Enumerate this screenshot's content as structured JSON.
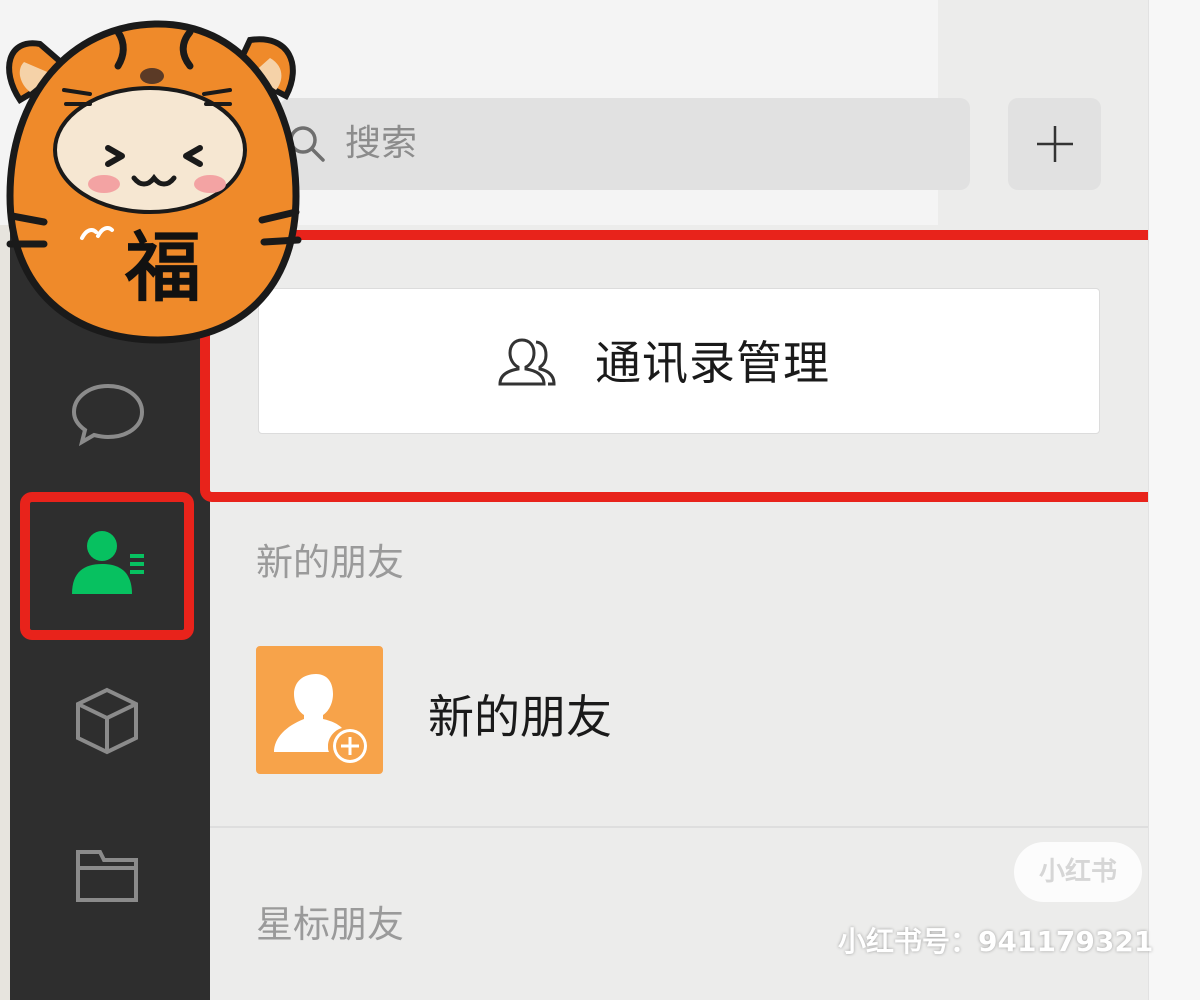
{
  "sticker": {
    "char": "福"
  },
  "search": {
    "placeholder": "搜索"
  },
  "toolbar": {
    "add_label": "+"
  },
  "manage": {
    "label": "通讯录管理"
  },
  "sections": [
    {
      "header": "新的朋友"
    },
    {
      "header": "星标朋友"
    }
  ],
  "contacts": [
    {
      "name": "新的朋友",
      "icon": "add-friend-icon"
    }
  ],
  "sidebar": {
    "items": [
      {
        "icon": "chat-icon"
      },
      {
        "icon": "contacts-icon",
        "selected": true
      },
      {
        "icon": "cube-icon"
      },
      {
        "icon": "folder-icon"
      }
    ]
  },
  "watermark": {
    "brand": "小红书",
    "id_text": "小红书号：941179321"
  },
  "colors": {
    "sidebar_bg": "#2e2e2e",
    "accent_green": "#07c160",
    "highlight_red": "#e8231b",
    "new_friend_orange": "#f7a34a"
  }
}
